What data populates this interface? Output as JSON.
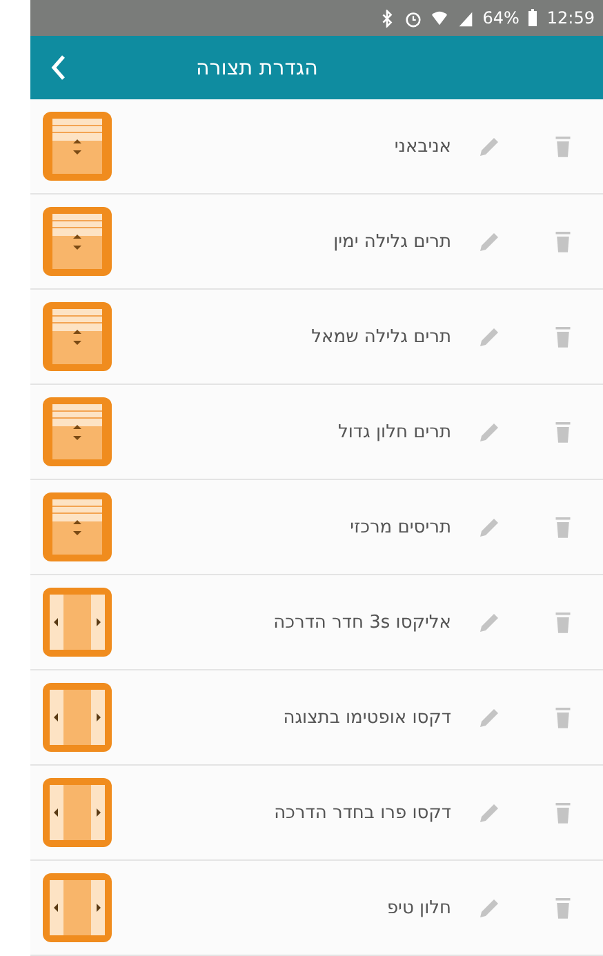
{
  "status_bar": {
    "battery": "64%",
    "time": "12:59"
  },
  "header": {
    "title": "הגדרת תצורה"
  },
  "items": [
    {
      "name": "אניבאני",
      "kind": "shutter"
    },
    {
      "name": "תרים גלילה ימין",
      "kind": "shutter"
    },
    {
      "name": "תרים גלילה שמאל",
      "kind": "shutter"
    },
    {
      "name": "תרים חלון גדול",
      "kind": "shutter"
    },
    {
      "name": "תריסים מרכזי",
      "kind": "shutter"
    },
    {
      "name": "אליקסו 3s חדר הדרכה",
      "kind": "curtain"
    },
    {
      "name": "דקסו אופטימו בתצוגה",
      "kind": "curtain"
    },
    {
      "name": "דקסו פרו בחדר הדרכה",
      "kind": "curtain"
    },
    {
      "name": "חלון טיפ",
      "kind": "curtain"
    }
  ]
}
